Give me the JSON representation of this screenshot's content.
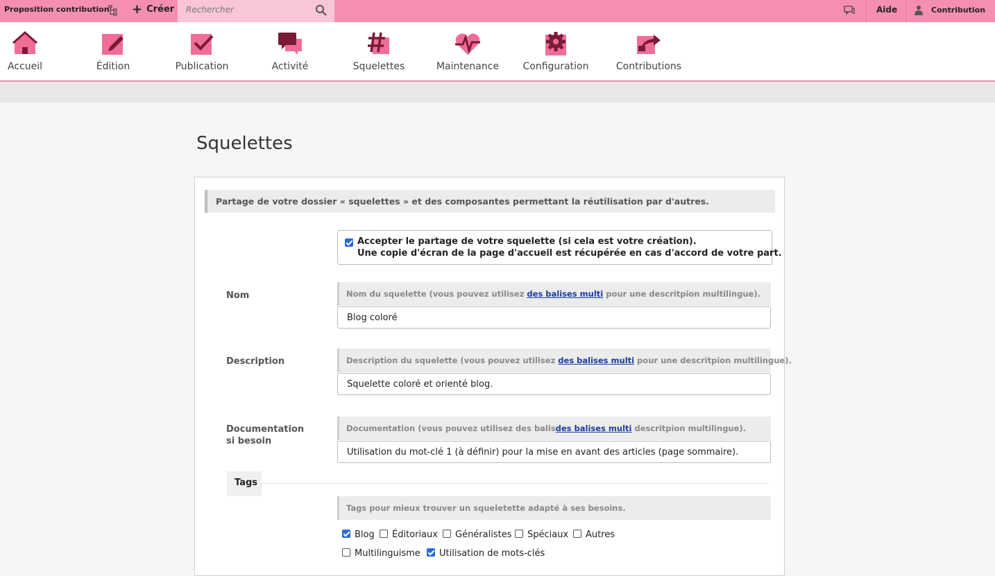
{
  "topbar": {
    "project": "Proposition contribution",
    "create": "Créer",
    "search_placeholder": "Rechercher",
    "help": "Aide",
    "user": "Contribution"
  },
  "nav": {
    "items": [
      {
        "label": "Accueil",
        "icon": "home-icon"
      },
      {
        "label": "Édition",
        "icon": "edit-icon"
      },
      {
        "label": "Publication",
        "icon": "publish-icon"
      },
      {
        "label": "Activité",
        "icon": "activity-icon"
      },
      {
        "label": "Squelettes",
        "icon": "hash-icon"
      },
      {
        "label": "Maintenance",
        "icon": "pulse-icon"
      },
      {
        "label": "Configuration",
        "icon": "gear-icon"
      },
      {
        "label": "Contributions",
        "icon": "share-icon"
      }
    ]
  },
  "page": {
    "title": "Squelettes",
    "explanation": "Partage de votre dossier « squelettes » et des composantes permettant la réutilisation par d'autres.",
    "accept": {
      "checked": true,
      "line1": "Accepter le partage de votre squelette (si cela est votre création).",
      "line2": "Une copie d'écran de la page d'accueil est récupérée en cas d'accord de votre part."
    },
    "fields": {
      "nom": {
        "label": "Nom",
        "hint_before": "Nom du squelette (vous pouvez utilisez",
        "hint_link": "des balises multi",
        "hint_after": "pour une descritpion multilingue).",
        "value": "Blog coloré"
      },
      "description": {
        "label": "Description",
        "hint_before": "Description du squelette (vous pouvez utilisez",
        "hint_link": "des balises multi",
        "hint_after": "pour une descritpion multilingue).",
        "value": "Squelette coloré et orienté blog."
      },
      "documentation": {
        "label_line1": "Documentation",
        "label_line2": "si besoin",
        "hint_before": "Documentation (vous pouvez utilisez des balis",
        "hint_link": "des balises multi",
        "hint_after": "descritpion multilingue).",
        "value": "Utilisation du mot-clé 1 (à définir) pour la mise en avant des articles (page sommaire)."
      }
    },
    "tags": {
      "legend": "Tags",
      "hint": "Tags pour mieux trouver un squeletette adapté à ses besoins.",
      "options": [
        {
          "label": "Blog",
          "checked": true
        },
        {
          "label": "Éditoriaux",
          "checked": false
        },
        {
          "label": "Généralistes",
          "checked": false
        },
        {
          "label": "Spéciaux",
          "checked": false
        },
        {
          "label": "Autres",
          "checked": false
        },
        {
          "label": "Multilinguisme",
          "checked": false
        },
        {
          "label": "Utilisation de mots-clés",
          "checked": true
        }
      ]
    }
  },
  "colors": {
    "topbar": "#f48fb1",
    "search": "#f8c6d6",
    "icon_light": "#f06d97",
    "icon_dark": "#7a1a37",
    "link": "#1b3c9b",
    "checkbox": "#2a6bd6"
  }
}
